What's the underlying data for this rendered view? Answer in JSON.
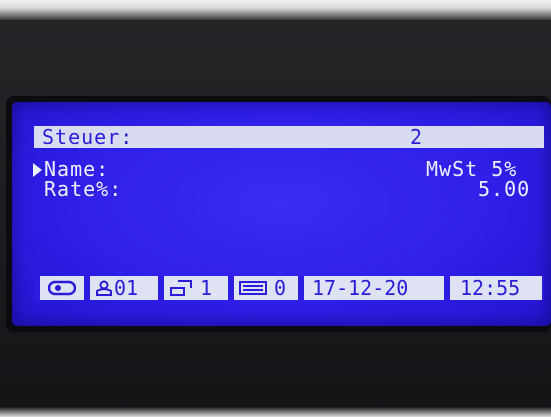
{
  "header": {
    "label": "Steuer:",
    "value": "2"
  },
  "fields": [
    {
      "label": "Name:",
      "value": "MwSt 5%",
      "selected": true
    },
    {
      "label": "Rate%:",
      "value": "5.00",
      "selected": false
    }
  ],
  "status_bar": {
    "mode_icon": "cash-drawer-icon",
    "operator_icon": "user-icon",
    "operator": "01",
    "register_icon": "register-icon",
    "register": "1",
    "keyboard_icon": "keyboard-icon",
    "keyboard": "0",
    "date": "17-12-20",
    "time": "12:55"
  },
  "colors": {
    "lcd_background": "#2f1fe8",
    "lcd_text": "#eef0ff",
    "highlight_bar": "#d9dcf0"
  }
}
